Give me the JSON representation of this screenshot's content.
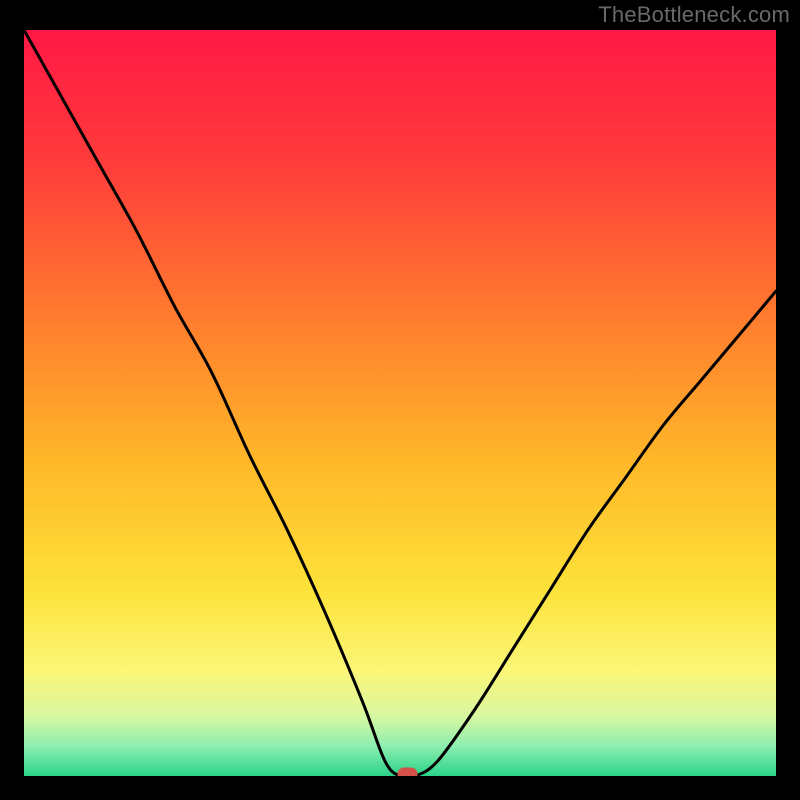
{
  "attribution": "TheBottleneck.com",
  "chart_data": {
    "type": "line",
    "title": "",
    "xlabel": "",
    "ylabel": "",
    "xlim": [
      0,
      100
    ],
    "ylim": [
      0,
      100
    ],
    "x": [
      0,
      5,
      10,
      15,
      20,
      25,
      30,
      35,
      40,
      45,
      48,
      50,
      52,
      55,
      60,
      65,
      70,
      75,
      80,
      85,
      90,
      95,
      100
    ],
    "values": [
      100,
      91,
      82,
      73,
      63,
      54,
      43,
      33,
      22,
      10,
      2,
      0,
      0,
      2,
      9,
      17,
      25,
      33,
      40,
      47,
      53,
      59,
      65
    ],
    "marker": {
      "x": 51,
      "y": 0,
      "color": "#d5524b"
    },
    "background_gradient": {
      "stops": [
        {
          "offset": 0.0,
          "color": "#ff1845"
        },
        {
          "offset": 0.18,
          "color": "#ff3c3b"
        },
        {
          "offset": 0.38,
          "color": "#ff7a2e"
        },
        {
          "offset": 0.58,
          "color": "#ffb829"
        },
        {
          "offset": 0.75,
          "color": "#fde239"
        },
        {
          "offset": 0.86,
          "color": "#fbf678"
        },
        {
          "offset": 0.92,
          "color": "#d8f7a1"
        },
        {
          "offset": 0.96,
          "color": "#8ceeb0"
        },
        {
          "offset": 1.0,
          "color": "#2bd38a"
        }
      ]
    }
  }
}
